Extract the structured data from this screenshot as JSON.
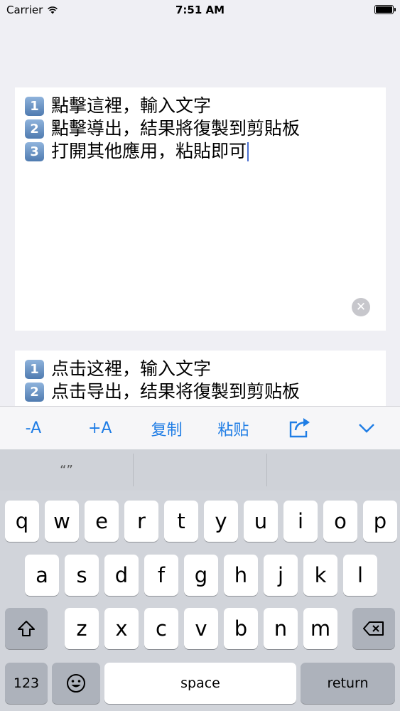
{
  "status_bar": {
    "carrier": "Carrier",
    "time": "7:51 AM",
    "battery_level": 1.0
  },
  "editor": {
    "lines": [
      {
        "num": "1",
        "text": "點擊這裡，輸入文字"
      },
      {
        "num": "2",
        "text": "點擊導出，結果將復製到剪貼板"
      },
      {
        "num": "3",
        "text": "打開其他應用，粘貼即可"
      }
    ],
    "clear_icon": "clear-icon"
  },
  "preview": {
    "lines": [
      {
        "num": "1",
        "text": "点击这裡，输入文字"
      },
      {
        "num": "2",
        "text": "点击导出，结果将復製到剪贴板"
      }
    ]
  },
  "toolbar": {
    "decrease_label": "-A",
    "increase_label": "+A",
    "copy_label": "复制",
    "paste_label": "粘贴",
    "share_icon": "share-icon",
    "dismiss_icon": "chevron-down-icon"
  },
  "keyboard": {
    "predictions": [
      "“”",
      "",
      ""
    ],
    "row1": [
      "q",
      "w",
      "e",
      "r",
      "t",
      "y",
      "u",
      "i",
      "o",
      "p"
    ],
    "row2": [
      "a",
      "s",
      "d",
      "f",
      "g",
      "h",
      "j",
      "k",
      "l"
    ],
    "row3": [
      "z",
      "x",
      "c",
      "v",
      "b",
      "n",
      "m"
    ],
    "numbers_label": "123",
    "space_label": "space",
    "return_label": "return"
  }
}
